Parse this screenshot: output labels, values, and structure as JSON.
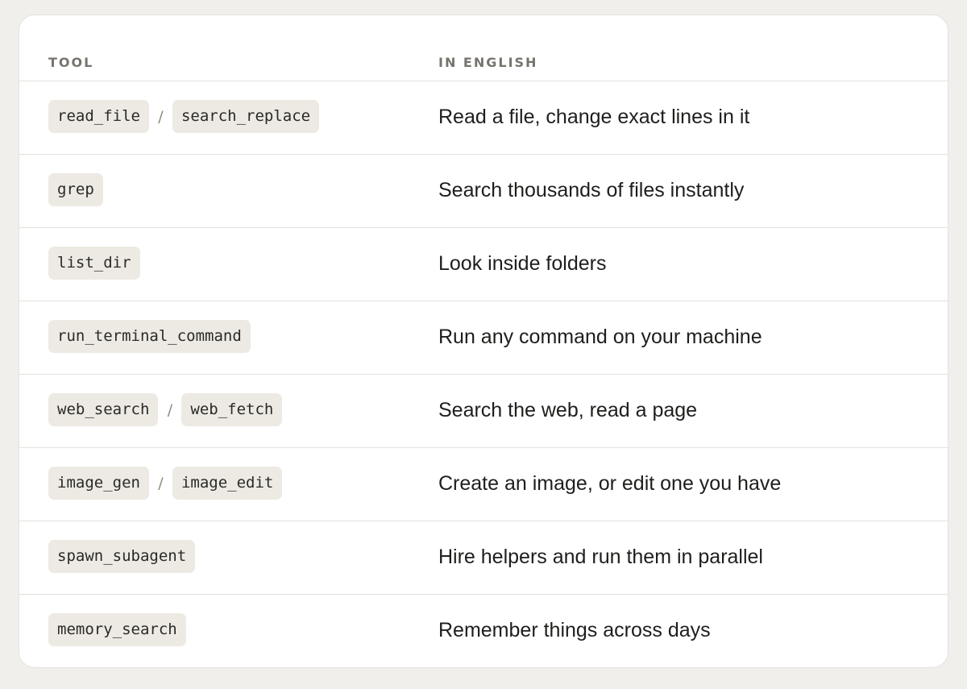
{
  "table": {
    "headers": {
      "tool": "TOOL",
      "english": "IN ENGLISH"
    },
    "separator": "/",
    "rows": [
      {
        "tools": [
          "read_file",
          "search_replace"
        ],
        "description": "Read a file, change exact lines in it"
      },
      {
        "tools": [
          "grep"
        ],
        "description": "Search thousands of files instantly"
      },
      {
        "tools": [
          "list_dir"
        ],
        "description": "Look inside folders"
      },
      {
        "tools": [
          "run_terminal_command"
        ],
        "description": "Run any command on your machine"
      },
      {
        "tools": [
          "web_search",
          "web_fetch"
        ],
        "description": "Search the web, read a page"
      },
      {
        "tools": [
          "image_gen",
          "image_edit"
        ],
        "description": "Create an image, or edit one you have"
      },
      {
        "tools": [
          "spawn_subagent"
        ],
        "description": "Hire helpers and run them in parallel"
      },
      {
        "tools": [
          "memory_search"
        ],
        "description": "Remember things across days"
      }
    ]
  }
}
